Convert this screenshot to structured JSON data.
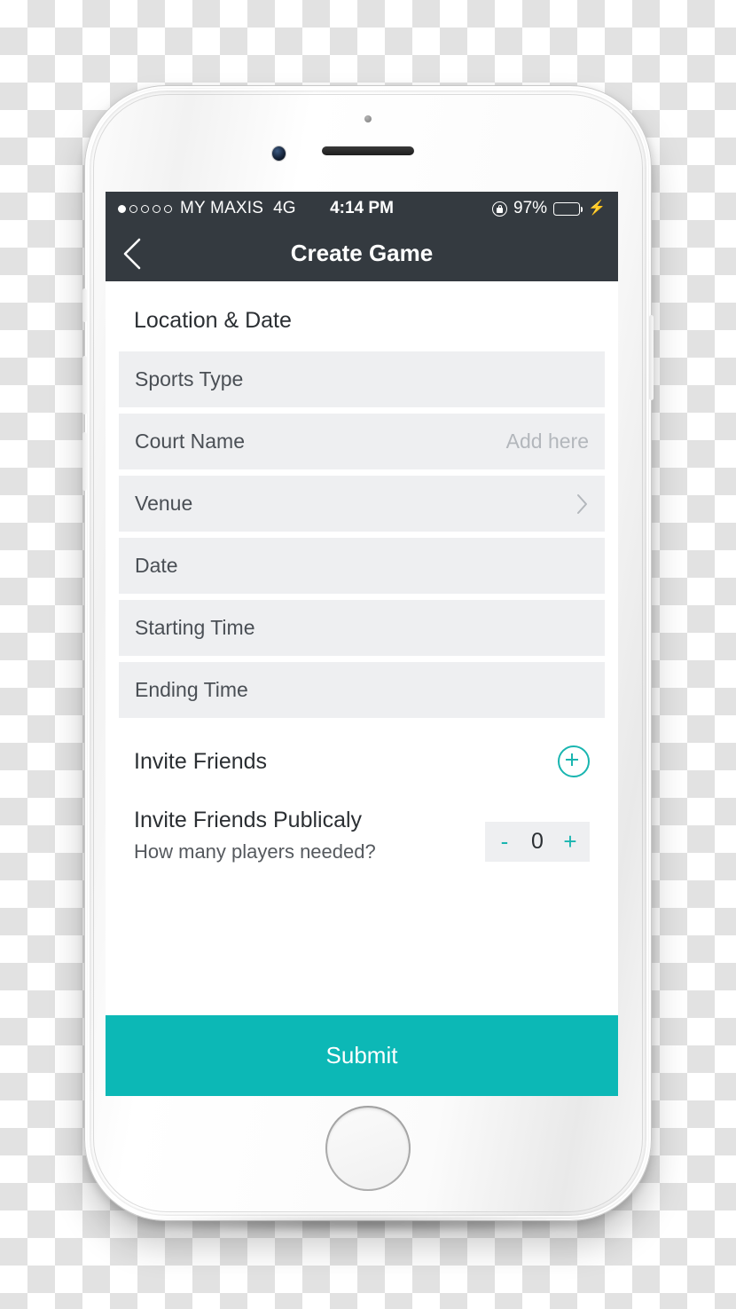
{
  "device": {
    "label": "white-smartphone-mockup",
    "hardware": {
      "front_camera": "camera-lens",
      "earpiece": "speaker-grille",
      "proximity_sensor": "proximity-sensor",
      "home_button": "home-button",
      "power_button": "power-button",
      "volume_up": "volume-up-button",
      "volume_down": "volume-down-button",
      "silent_switch": "silent-switch"
    }
  },
  "status_bar": {
    "signal_dots_total": 5,
    "signal_dots_filled": 1,
    "carrier": "MY MAXIS",
    "network": "4G",
    "time": "4:14 PM",
    "rotation_lock_icon": "rotation-lock-icon",
    "battery_percent": "97%",
    "battery_level": 97,
    "battery_color": "#4cd964",
    "charging_icon": "⚡"
  },
  "nav_bar": {
    "back_icon": "back-chevron-icon",
    "title": "Create Game",
    "background": "#343a40"
  },
  "form": {
    "section_title": "Location & Date",
    "fields": [
      {
        "label": "Sports Type",
        "value": "",
        "accessory": "none"
      },
      {
        "label": "Court Name",
        "value": "Add here",
        "accessory": "none"
      },
      {
        "label": "Venue",
        "value": "",
        "accessory": "chevron"
      },
      {
        "label": "Date",
        "value": "",
        "accessory": "none"
      },
      {
        "label": "Starting Time",
        "value": "",
        "accessory": "none"
      },
      {
        "label": "Ending Time",
        "value": "",
        "accessory": "none"
      }
    ]
  },
  "invite": {
    "title": "Invite Friends",
    "add_icon": "plus-circle-icon",
    "public_title": "Invite Friends Publicaly",
    "public_subtitle": "How many players needed?",
    "stepper": {
      "decrement_label": "-",
      "value": "0",
      "increment_label": "+"
    }
  },
  "submit": {
    "label": "Submit",
    "background": "#0cb8b6"
  },
  "colors": {
    "accent_teal": "#0cb8b6",
    "accent_teal_icon": "#19b5b0",
    "navbar_dark": "#343a40",
    "field_bg": "#eeeff1",
    "text_primary": "#2b2f33",
    "text_secondary": "#4a4f55",
    "placeholder": "#b3b7bc"
  }
}
